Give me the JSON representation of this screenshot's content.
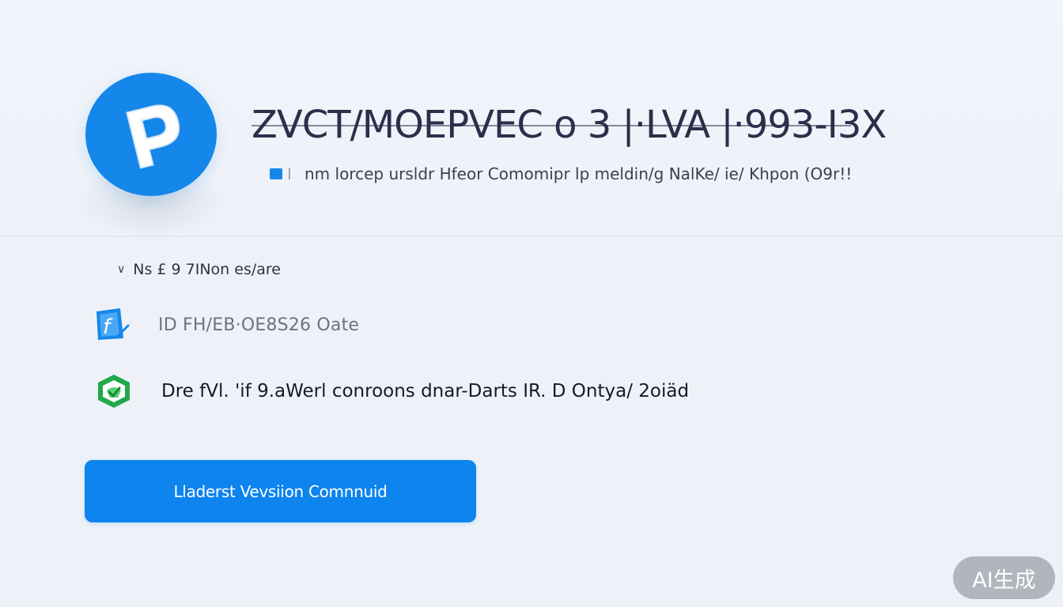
{
  "header": {
    "title": "ZVCT/MOEPVEC o 3 |·LVA |·993-I3X",
    "subtitle": "nm lorcep ursldr Hfeor Comomipr lp meldin/g NalKe/ ie/ Khpon (O9r!!"
  },
  "logo": {
    "letter": "P",
    "color": "#1587ea"
  },
  "section": {
    "label": "Ns £ 9 7INon es/are",
    "chevron_icon": "chevron-down-icon"
  },
  "rows": [
    {
      "icon": "app-f-icon",
      "icon_color": "#1587ea",
      "text": "ID FH/EB·OE8S26 Oate"
    },
    {
      "icon": "shield-check-icon",
      "icon_color": "#22a94a",
      "text": "Dre  fVl.  'if  9.aWerl  conroons  dnar-Darts  IR.  D Ontya/ 2oiäd"
    }
  ],
  "cta": {
    "label": "Lladerst Vevsiion Comnnuid",
    "color": "#0d84ee"
  },
  "watermark": {
    "text": "AI生成"
  }
}
